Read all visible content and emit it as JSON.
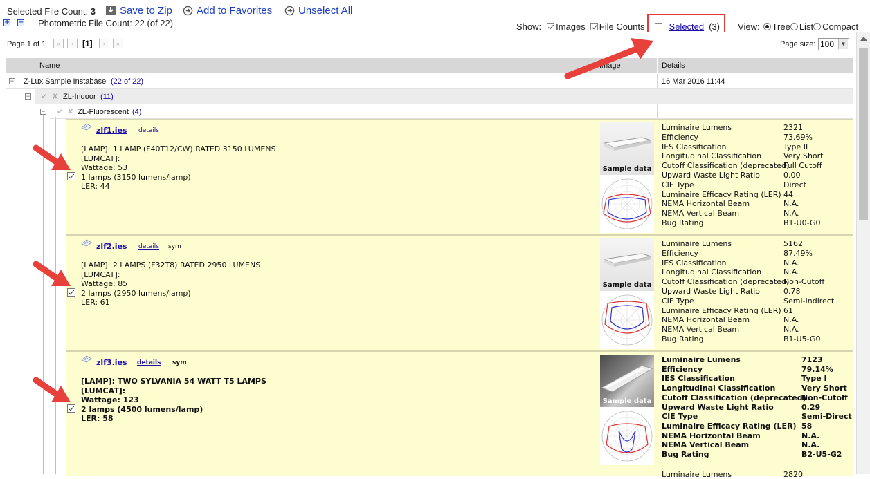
{
  "toolbar": {
    "selected_label": "Selected File Count:",
    "selected_count": "3",
    "save_zip": "Save to Zip",
    "add_favorites": "Add to Favorites",
    "unselect_all": "Unselect All",
    "photometric_count": "Photometric File Count: 22 (of 22)"
  },
  "show": {
    "label": "Show:",
    "images": "Images",
    "file_counts": "File Counts",
    "selected_link": "Selected",
    "selected_count": "(3)",
    "view_label": "View:",
    "tree": "Tree",
    "list": "List",
    "compact": "Compact",
    "view_selected": "Tree"
  },
  "pager": {
    "page_info": "Page 1 of 1",
    "current": "[1]",
    "page_size_label": "Page size:",
    "page_size_value": "100"
  },
  "columns": {
    "name": "Name",
    "image": "Image",
    "details": "Details"
  },
  "tree": {
    "root": {
      "label": "Z-Lux Sample Instabase",
      "count": "(22 of 22)",
      "date": "16 Mar 2016 11:44"
    },
    "indoor": {
      "label": "ZL-Indoor",
      "count": "(11)"
    },
    "fluorescent": {
      "label": "ZL-Fluorescent",
      "count": "(4)"
    }
  },
  "detail_keys": [
    "Luminaire Lumens",
    "Efficiency",
    "IES Classification",
    "Longitudinal Classification",
    "Cutoff Classification (deprecated)",
    "Upward Waste Light Ratio",
    "CIE Type",
    "Luminaire Efficacy Rating (LER)",
    "NEMA Horizontal Beam",
    "NEMA Vertical Beam",
    "Bug Rating"
  ],
  "items": [
    {
      "file": "zlf1.ies",
      "details_link": "details",
      "sym": "",
      "lines": [
        "[LAMP]: 1 LAMP (F40T12/CW) RATED 3150 LUMENS",
        "[LUMCAT]:",
        "Wattage: 53",
        "1 lamps (3150 lumens/lamp)",
        "LER: 44"
      ],
      "image_caption": "Sample data",
      "values": [
        "2321",
        "73.69%",
        "Type II",
        "Very Short",
        "Full Cutoff",
        "0.00",
        "Direct",
        "44",
        "N.A.",
        "N.A.",
        "B1-U0-G0"
      ]
    },
    {
      "file": "zlf2.ies",
      "details_link": "details",
      "sym": "sym",
      "lines": [
        "[LAMP]: 2 LAMPS (F32T8) RATED 2950 LUMENS",
        "[LUMCAT]:",
        "Wattage: 85",
        "2 lamps (2950 lumens/lamp)",
        "LER: 61"
      ],
      "image_caption": "Sample data",
      "values": [
        "5162",
        "87.49%",
        "N.A.",
        "N.A.",
        "Non-Cutoff",
        "0.78",
        "Semi-Indirect",
        "61",
        "N.A.",
        "N.A.",
        "B1-U5-G0"
      ]
    },
    {
      "file": "zlf3.ies",
      "details_link": "details",
      "sym": "sym",
      "lines": [
        "[LAMP]: TWO SYLVANIA 54 WATT T5 LAMPS",
        "[LUMCAT]:",
        "Wattage: 123",
        "2 lamps (4500 lumens/lamp)",
        "LER: 58"
      ],
      "image_caption": "Sample data",
      "values": [
        "7123",
        "79.14%",
        "Type I",
        "Very Short",
        "Non-Cutoff",
        "0.29",
        "Semi-Direct",
        "58",
        "N.A.",
        "N.A.",
        "B2-U5-G2"
      ]
    }
  ],
  "partial_item": {
    "key": "Luminaire Lumens",
    "value": "2820"
  },
  "colors": {
    "highlight_box": "#e23a3a",
    "arrow": "#e8403a",
    "row_bg": "#fdfdd0",
    "link": "#1a0dab"
  }
}
